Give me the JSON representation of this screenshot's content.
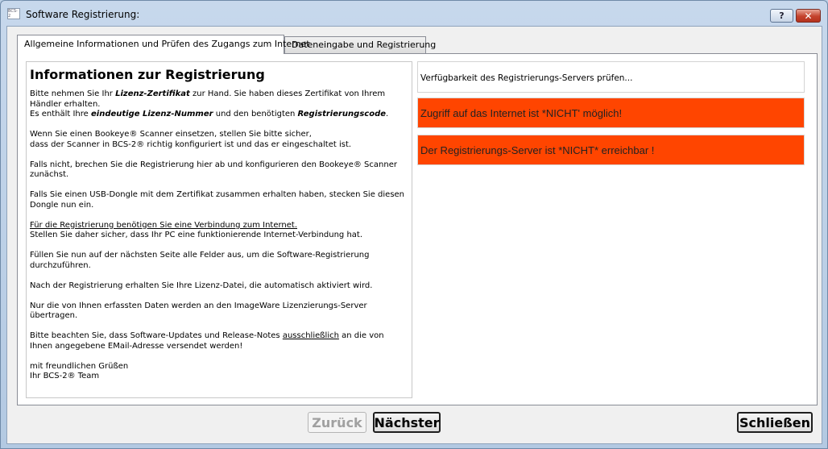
{
  "window": {
    "title": "Software Registrierung:",
    "icon_text": "BCS-2",
    "help_label": "?",
    "close_label": "✕"
  },
  "tabs": [
    {
      "label": "Allgemeine Informationen und Prüfen des Zugangs zum Internet",
      "active": true
    },
    {
      "label": "Dateneingabe und Registrierung",
      "active": false
    }
  ],
  "info": {
    "title": "Informationen zur Registrierung",
    "p1_a": "Bitte nehmen Sie Ihr ",
    "p1_b": "Lizenz-Zertifikat",
    "p1_c": " zur Hand. Sie haben dieses Zertifikat von Ihrem Händler erhalten.",
    "p1_d": "Es enthält Ihre ",
    "p1_e": "eindeutige Lizenz-Nummer",
    "p1_f": " und den benötigten ",
    "p1_g": "Registrierungscode",
    "p1_h": ".",
    "p2_a": "Wenn Sie einen Bookeye® Scanner einsetzen, stellen Sie bitte sicher,",
    "p2_b": "dass der Scanner in BCS-2® richtig konfiguriert ist und das er eingeschaltet ist.",
    "p3": "Falls nicht, brechen Sie die Registrierung hier ab und konfigurieren den Bookeye® Scanner zunächst.",
    "p4": "Falls Sie einen USB-Dongle mit dem Zertifikat zusammen erhalten haben, stecken Sie diesen Dongle nun ein.",
    "p5_a": "Für die Registrierung benötigen Sie eine Verbindung zum Internet.",
    "p5_b": "Stellen Sie daher sicher, dass Ihr PC eine funktionierende Internet-Verbindung hat.",
    "p6": "Füllen Sie nun auf der nächsten Seite alle Felder aus, um die Software-Registrierung durchzuführen.",
    "p7": "Nach der Registrierung erhalten Sie Ihre Lizenz-Datei, die automatisch aktiviert wird.",
    "p8": "Nur die von Ihnen erfassten Daten werden an den ImageWare Lizenzierungs-Server übertragen.",
    "p9_a": "Bitte beachten Sie, dass Software-Updates und Release-Notes ",
    "p9_b": "ausschließlich",
    "p9_c": " an die von Ihnen angegebene EMail-Adresse versendet werden!",
    "p10_a": "mit freundlichen Grüßen",
    "p10_b": "Ihr BCS-2® Team"
  },
  "status": {
    "checking": "Verfügbarkeit des Registrierungs-Servers prüfen...",
    "error_internet": "Zugriff auf das Internet ist *NICHT' möglich!",
    "error_server": "Der Registrierungs-Server ist *NICHT* erreichbar !",
    "error_color": "#ff4500"
  },
  "footer": {
    "back_label": "Zurück",
    "next_label": "Nächster",
    "close_label": "Schließen"
  }
}
